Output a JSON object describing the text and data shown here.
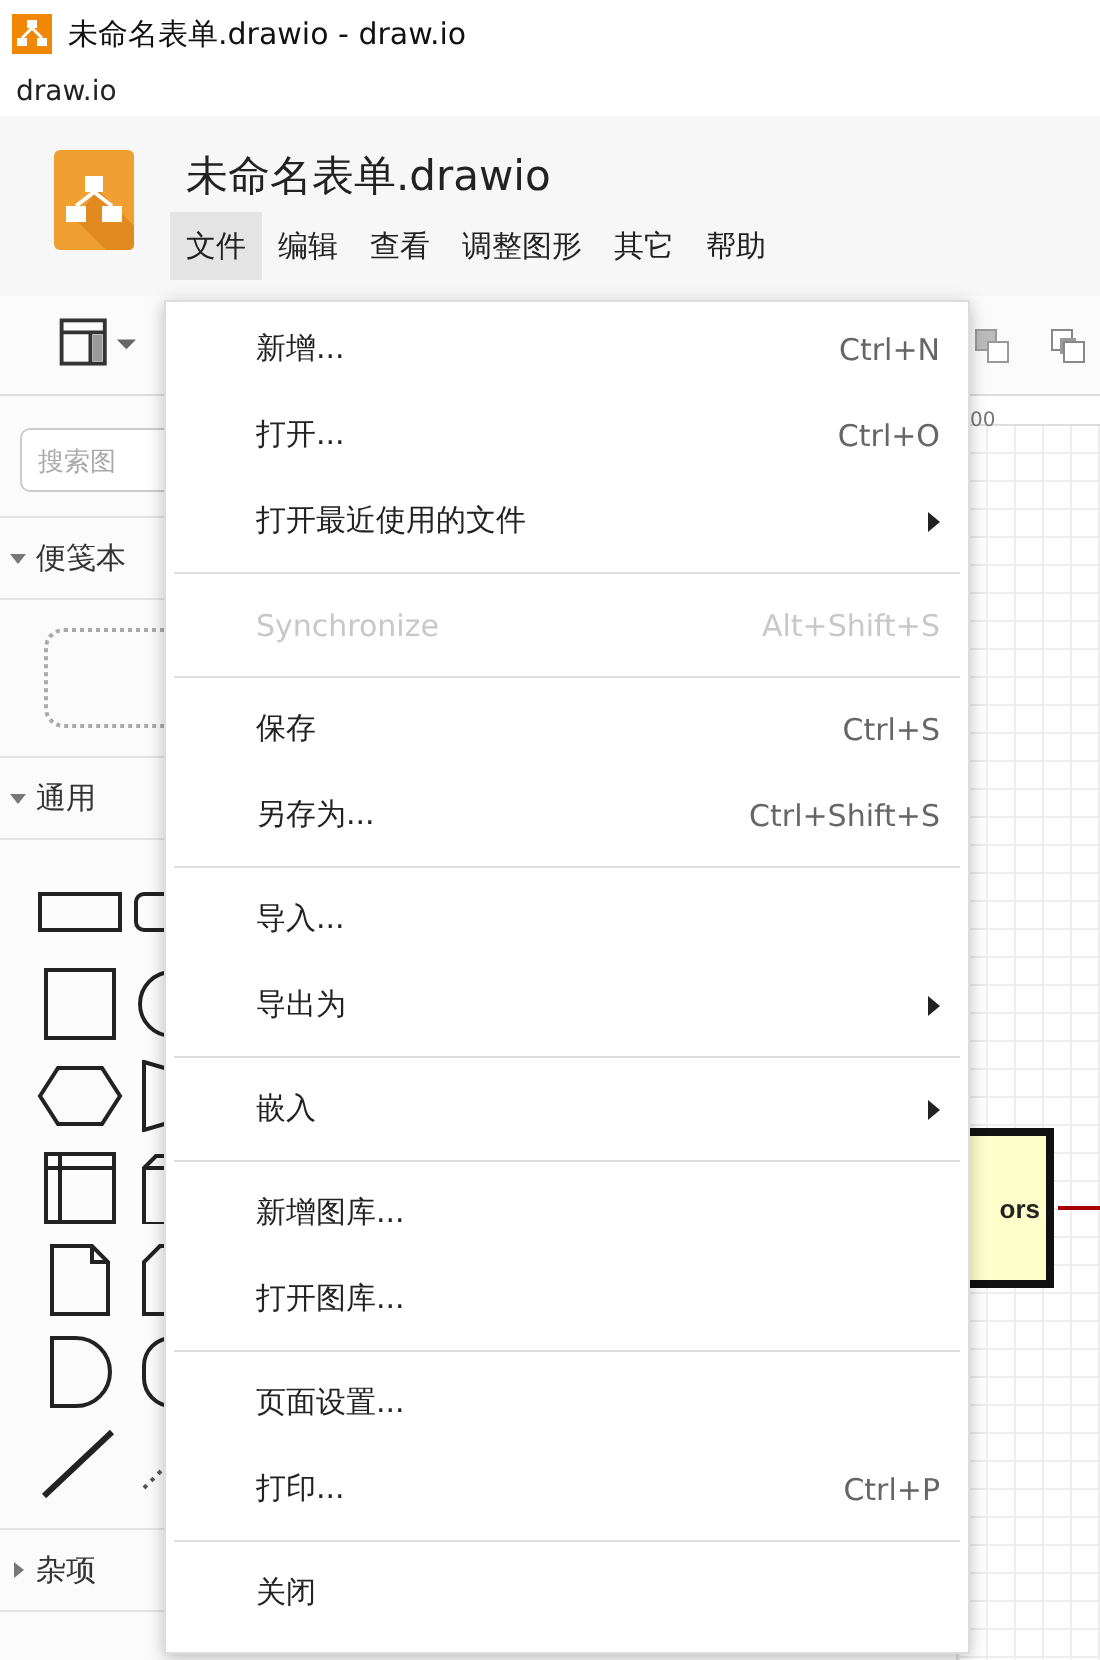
{
  "window": {
    "title": "未命名表单.drawio - draw.io"
  },
  "app_menu": [
    "draw.io"
  ],
  "header": {
    "title": "未命名表单.drawio"
  },
  "menubar": [
    {
      "label": "文件",
      "selected": true
    },
    {
      "label": "编辑",
      "selected": false
    },
    {
      "label": "查看",
      "selected": false
    },
    {
      "label": "调整图形",
      "selected": false
    },
    {
      "label": "其它",
      "selected": false
    },
    {
      "label": "帮助",
      "selected": false
    }
  ],
  "sidebar": {
    "search": {
      "placeholder": "搜索图"
    },
    "sections": [
      {
        "title": "便笺本",
        "expanded": true
      },
      {
        "title": "通用",
        "expanded": true
      },
      {
        "title": "杂项",
        "expanded": false
      }
    ]
  },
  "canvas": {
    "ruler_label": "00",
    "shape_text": "ors"
  },
  "file_menu": [
    {
      "kind": "item",
      "label": "新增...",
      "shortcut": "Ctrl+N",
      "submenu": false,
      "disabled": false
    },
    {
      "kind": "item",
      "label": "打开...",
      "shortcut": "Ctrl+O",
      "submenu": false,
      "disabled": false
    },
    {
      "kind": "item",
      "label": "打开最近使用的文件",
      "submenu": true,
      "disabled": false
    },
    {
      "kind": "separator"
    },
    {
      "kind": "item",
      "label": "Synchronize",
      "shortcut": "Alt+Shift+S",
      "submenu": false,
      "disabled": true
    },
    {
      "kind": "separator"
    },
    {
      "kind": "item",
      "label": "保存",
      "shortcut": "Ctrl+S",
      "submenu": false,
      "disabled": false
    },
    {
      "kind": "item",
      "label": "另存为...",
      "shortcut": "Ctrl+Shift+S",
      "submenu": false,
      "disabled": false
    },
    {
      "kind": "separator"
    },
    {
      "kind": "item",
      "label": "导入...",
      "submenu": false,
      "disabled": false
    },
    {
      "kind": "item",
      "label": "导出为",
      "submenu": true,
      "disabled": false
    },
    {
      "kind": "separator"
    },
    {
      "kind": "item",
      "label": "嵌入",
      "submenu": true,
      "disabled": false
    },
    {
      "kind": "separator"
    },
    {
      "kind": "item",
      "label": "新增图库...",
      "submenu": false,
      "disabled": false
    },
    {
      "kind": "item",
      "label": "打开图库...",
      "submenu": false,
      "disabled": false
    },
    {
      "kind": "separator"
    },
    {
      "kind": "item",
      "label": "页面设置...",
      "submenu": false,
      "disabled": false
    },
    {
      "kind": "item",
      "label": "打印...",
      "shortcut": "Ctrl+P",
      "submenu": false,
      "disabled": false
    },
    {
      "kind": "separator"
    },
    {
      "kind": "item",
      "label": "关闭",
      "submenu": false,
      "disabled": false
    }
  ]
}
